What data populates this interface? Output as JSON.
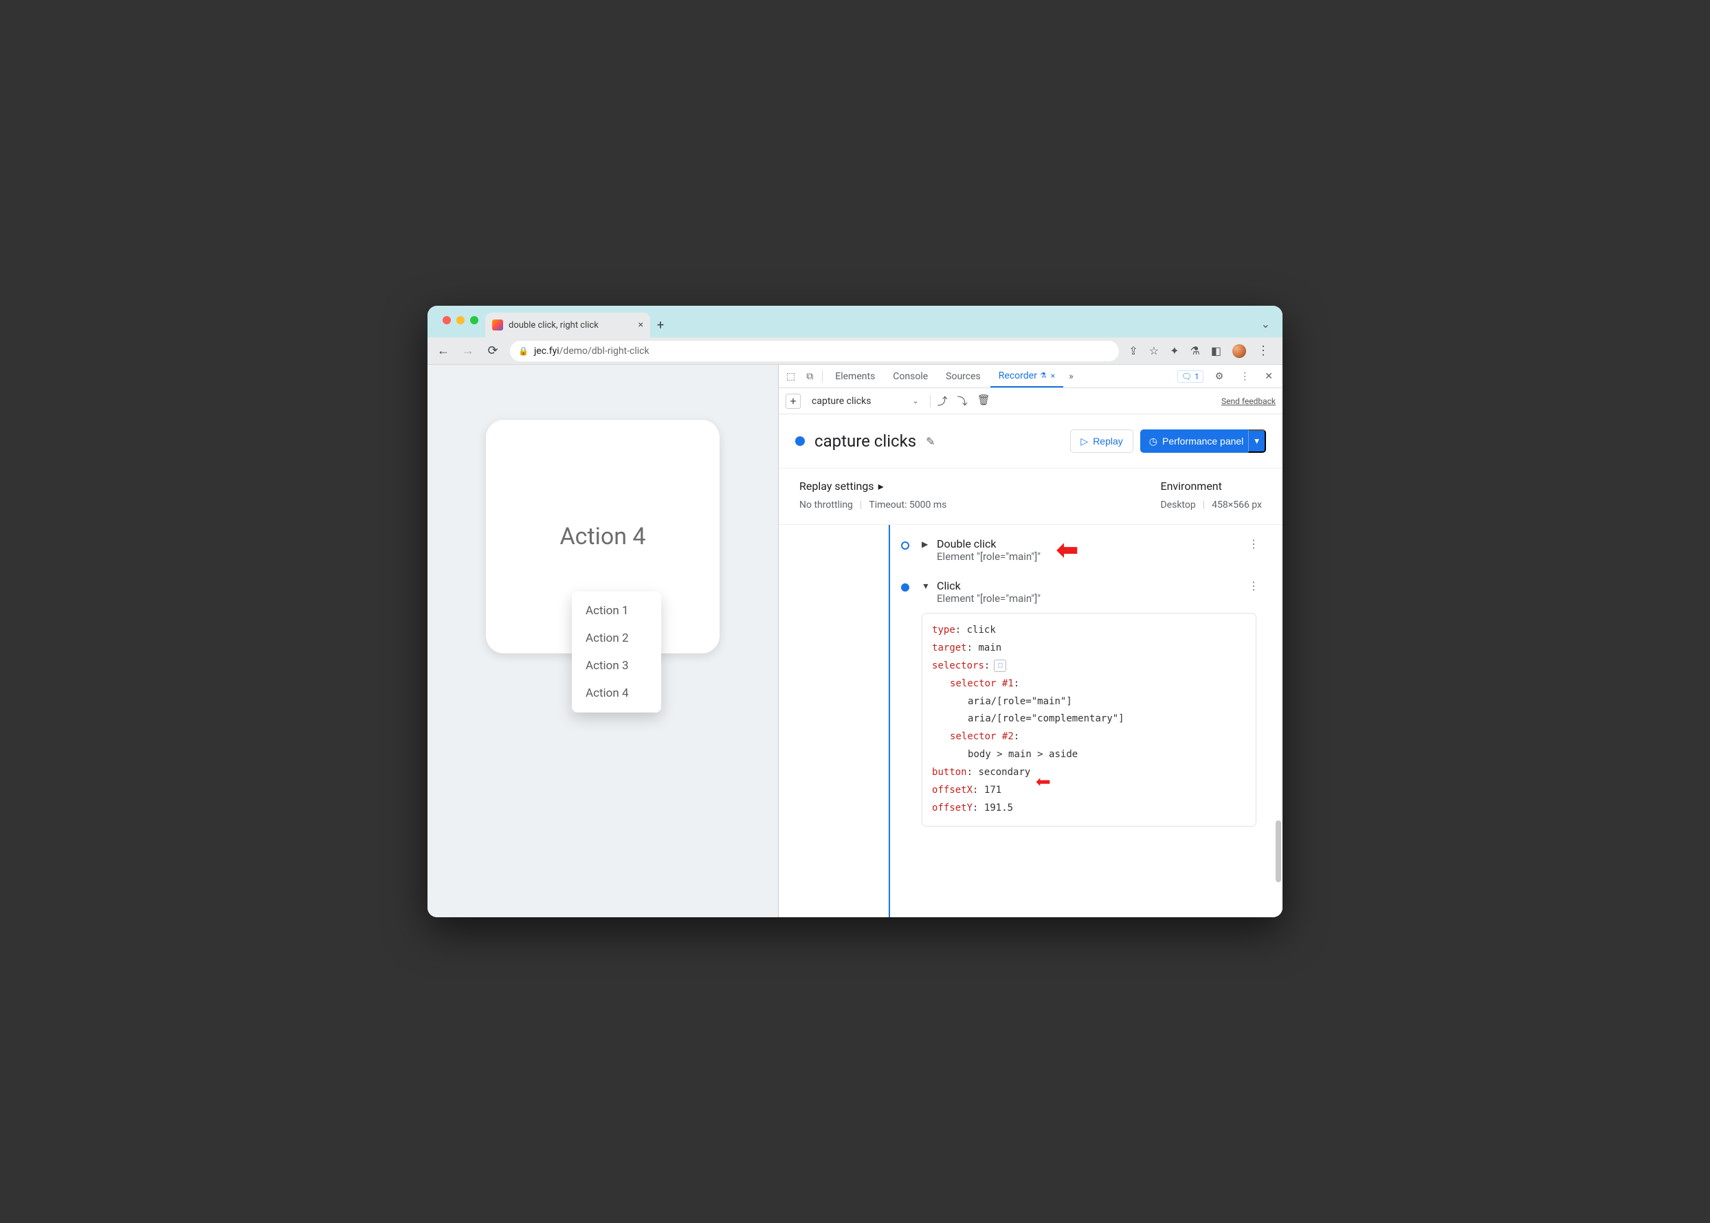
{
  "browser": {
    "tab_title": "double click, right click",
    "url_host": "jec.fyi",
    "url_path": "/demo/dbl-right-click"
  },
  "page": {
    "card_text": "Action 4",
    "context_menu": [
      "Action 1",
      "Action 2",
      "Action 3",
      "Action 4"
    ]
  },
  "devtools": {
    "tabs": {
      "elements": "Elements",
      "console": "Console",
      "sources": "Sources",
      "recorder": "Recorder"
    },
    "issues_count": "1",
    "send_feedback": "Send feedback",
    "recording_select": "capture clicks",
    "recording_title": "capture clicks",
    "replay_label": "Replay",
    "perf_label": "Performance panel",
    "settings": {
      "replay_title": "Replay settings",
      "throttling": "No throttling",
      "timeout": "Timeout: 5000 ms",
      "env_title": "Environment",
      "device": "Desktop",
      "viewport": "458×566 px"
    },
    "steps": [
      {
        "title": "Double click",
        "subtitle": "Element \"[role=\"main\"]\"",
        "expanded": false
      },
      {
        "title": "Click",
        "subtitle": "Element \"[role=\"main\"]\"",
        "expanded": true,
        "details": {
          "type_k": "type",
          "type_v": ": click",
          "target_k": "target",
          "target_v": ": main",
          "selectors_k": "selectors",
          "selectors_v": ":",
          "sel1_k": "selector #1",
          "sel1_v": ":",
          "sel1_a": "aria/[role=\"main\"]",
          "sel1_b": "aria/[role=\"complementary\"]",
          "sel2_k": "selector #2",
          "sel2_v": ":",
          "sel2_a": "body > main > aside",
          "button_k": "button",
          "button_v": ": secondary",
          "offx_k": "offsetX",
          "offx_v": ": 171",
          "offy_k": "offsetY",
          "offy_v": ": 191.5"
        }
      }
    ]
  }
}
